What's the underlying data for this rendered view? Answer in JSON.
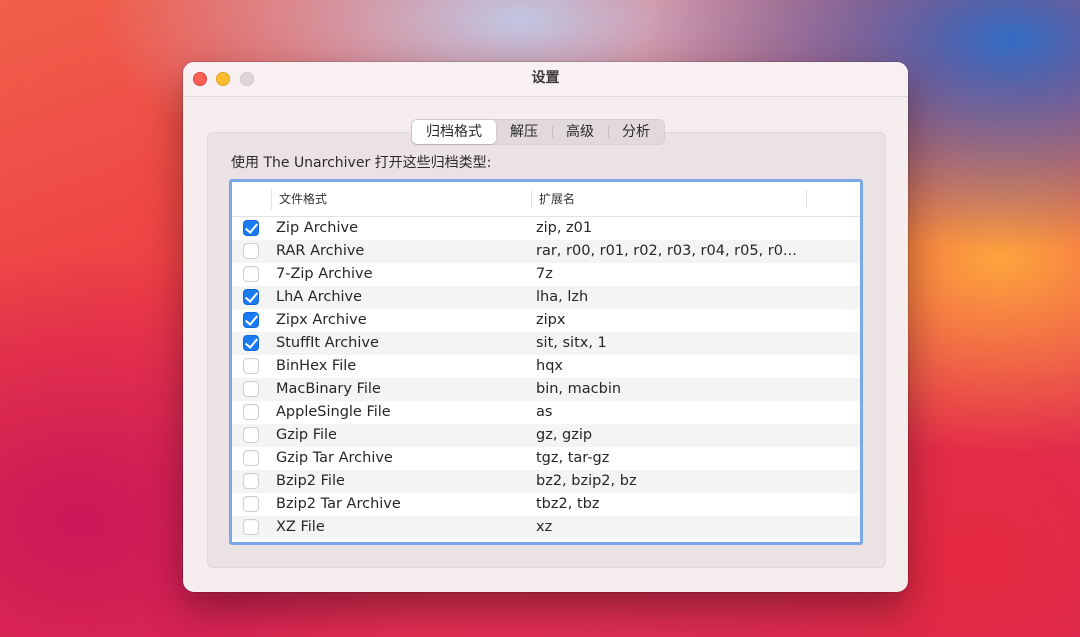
{
  "window": {
    "title": "设置"
  },
  "tabs": [
    {
      "label": "归档格式",
      "selected": true
    },
    {
      "label": "解压",
      "selected": false
    },
    {
      "label": "高级",
      "selected": false
    },
    {
      "label": "分析",
      "selected": false
    }
  ],
  "instruction": "使用 The Unarchiver 打开这些归档类型:",
  "table": {
    "columns": [
      "文件格式",
      "扩展名"
    ],
    "rows": [
      {
        "checked": true,
        "format": "Zip Archive",
        "extensions": "zip, z01"
      },
      {
        "checked": false,
        "format": "RAR Archive",
        "extensions": "rar, r00, r01, r02, r03, r04, r05, r0..."
      },
      {
        "checked": false,
        "format": "7-Zip Archive",
        "extensions": "7z"
      },
      {
        "checked": true,
        "format": "LhA Archive",
        "extensions": "lha, lzh"
      },
      {
        "checked": true,
        "format": "Zipx Archive",
        "extensions": "zipx"
      },
      {
        "checked": true,
        "format": "StuffIt Archive",
        "extensions": "sit, sitx, 1"
      },
      {
        "checked": false,
        "format": "BinHex File",
        "extensions": "hqx"
      },
      {
        "checked": false,
        "format": "MacBinary File",
        "extensions": "bin, macbin"
      },
      {
        "checked": false,
        "format": "AppleSingle File",
        "extensions": "as"
      },
      {
        "checked": false,
        "format": "Gzip File",
        "extensions": "gz, gzip"
      },
      {
        "checked": false,
        "format": "Gzip Tar Archive",
        "extensions": "tgz, tar-gz"
      },
      {
        "checked": false,
        "format": "Bzip2 File",
        "extensions": "bz2, bzip2, bz"
      },
      {
        "checked": false,
        "format": "Bzip2 Tar Archive",
        "extensions": "tbz2, tbz"
      },
      {
        "checked": false,
        "format": "XZ File",
        "extensions": "xz"
      }
    ]
  },
  "colors": {
    "accent": "#1a7cf4",
    "focus_ring": "#7aa7e6",
    "close": "#fe5f57",
    "minimize": "#febc2e",
    "zoom_inactive": "#dcd6d6"
  }
}
